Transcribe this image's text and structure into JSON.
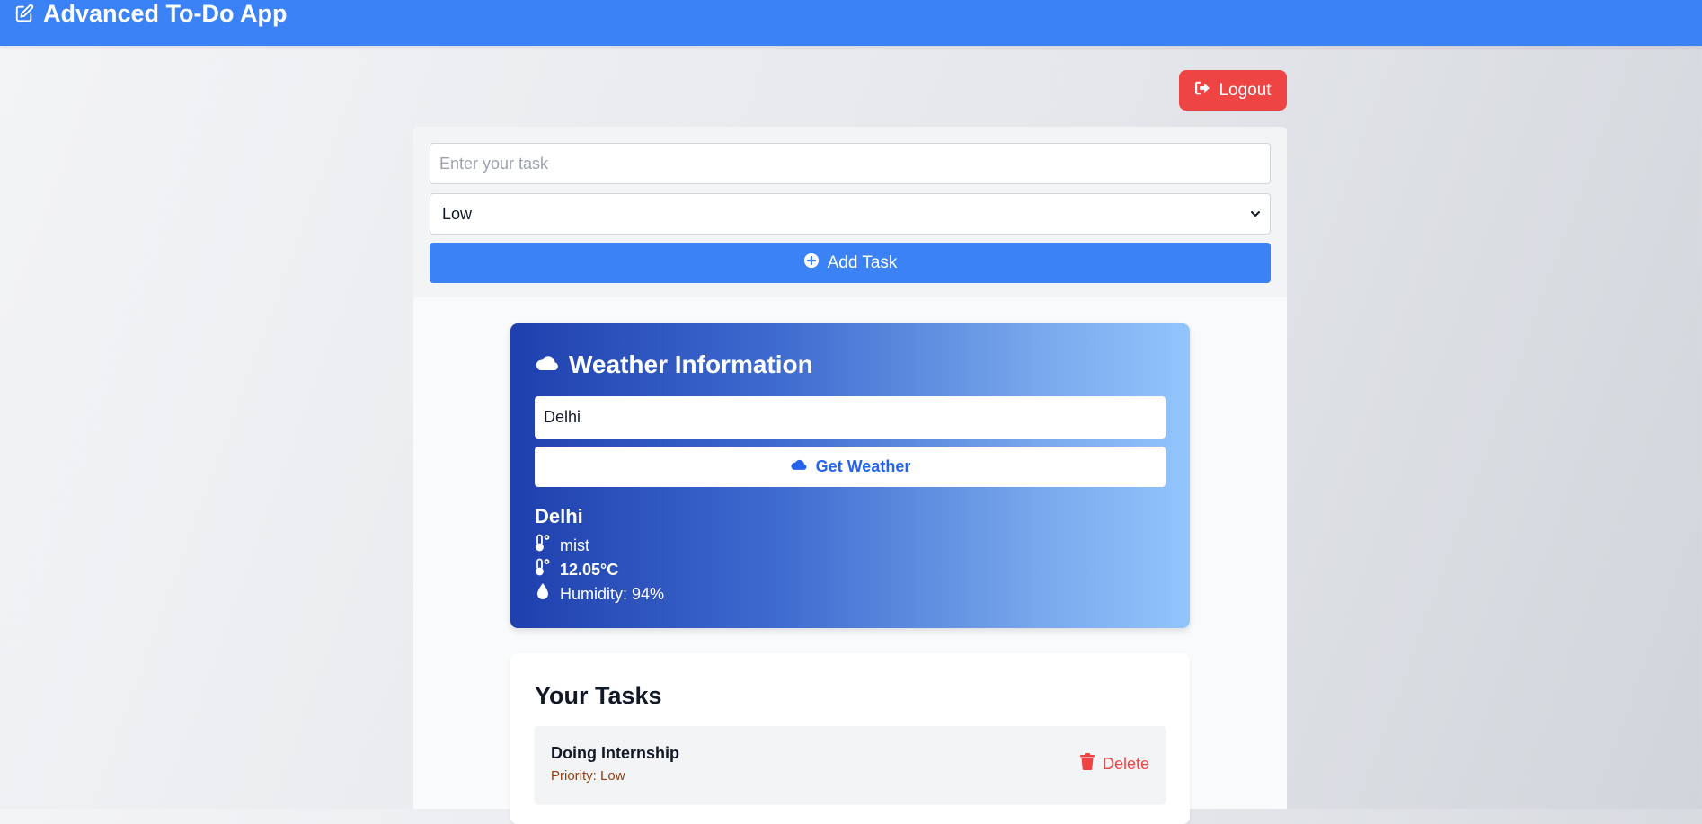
{
  "header": {
    "title": "Advanced To-Do App",
    "icon": "edit-square-icon",
    "color": "#3b82f6"
  },
  "logout": {
    "label": "Logout",
    "icon": "sign-out-icon",
    "color": "#ef4444"
  },
  "task_form": {
    "task_input": {
      "value": "",
      "placeholder": "Enter your task"
    },
    "priority_select": {
      "selected": "Low"
    },
    "add_button": {
      "label": "Add Task",
      "icon": "plus-circle-icon"
    }
  },
  "weather": {
    "title": "Weather Information",
    "title_icon": "cloud-icon",
    "city_input_value": "Delhi",
    "get_button_label": "Get Weather",
    "get_button_icon": "cloud-icon",
    "result": {
      "city": "Delhi",
      "description": "mist",
      "temperature": "12.05°C",
      "humidity": "Humidity: 94%"
    }
  },
  "tasks": {
    "heading": "Your Tasks",
    "items": [
      {
        "name": "Doing Internship",
        "priority": "Priority: Low",
        "delete_label": "Delete",
        "delete_icon": "trash-icon"
      }
    ]
  }
}
